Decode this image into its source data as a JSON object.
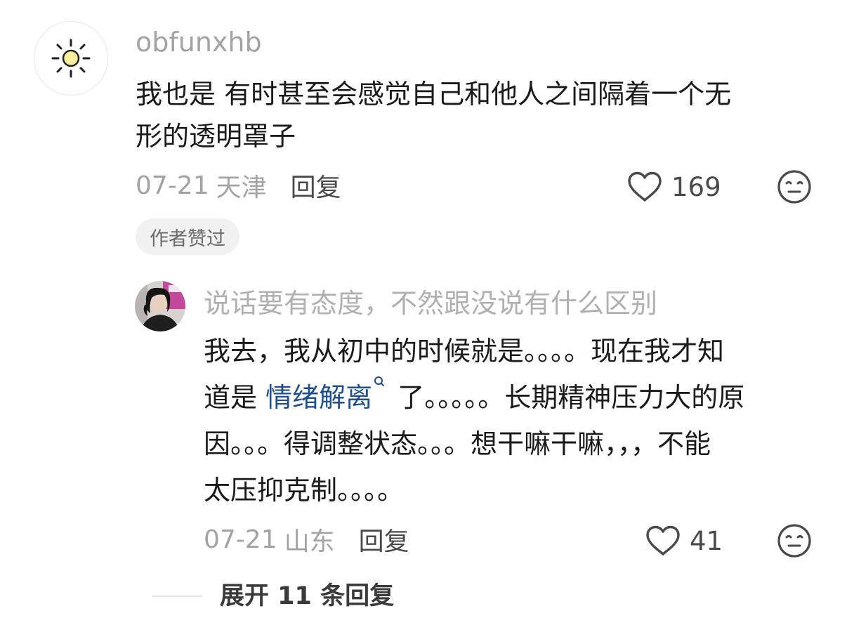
{
  "comment": {
    "avatar_icon": "sun-icon",
    "username": "obfunxhb",
    "text_lines": [
      "我也是 有时甚至会感觉自己和他人之间隔着一个无",
      "形的透明罩子"
    ],
    "date": "07-21",
    "location": "天津",
    "reply_label": "回复",
    "like_count": "169",
    "author_liked_badge": "作者赞过",
    "emoji_icon": "meh-face-icon",
    "like_icon": "heart-outline-icon"
  },
  "reply": {
    "username": "说话要有态度，不然跟没说有什么区别",
    "line1": "我去，我从初中的时候就是。。。。现在我才知",
    "line2_before": "道是 ",
    "line2_link": "情绪解离",
    "line2_after": " 了。。。。。长期精神压力大的原",
    "line3": "因。。。得调整状态。。。想干嘛干嘛，，，不能",
    "line4": "太压抑克制。。。。",
    "date": "07-21",
    "location": "山东",
    "reply_label": "回复",
    "like_count": "41"
  },
  "expand": {
    "label": "展开 11 条回复"
  },
  "colors": {
    "secondary_text": "#a3a3a3",
    "link": "#1f4e8c",
    "badge_bg": "#f1f1f1"
  }
}
